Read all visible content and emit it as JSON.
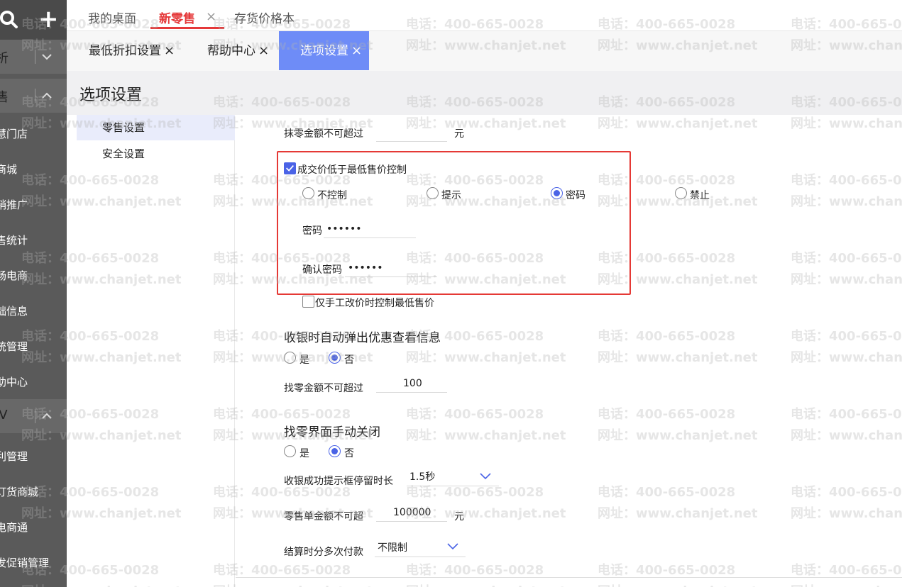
{
  "sidebar": {
    "sections": [
      {
        "label": "析"
      },
      {
        "label": "售"
      },
      {
        "label": "Ⅳ"
      }
    ],
    "items": [
      "慧门店",
      "商城",
      "销推广",
      "售统计",
      "畅电商",
      "础信息",
      "统管理",
      "助中心",
      "利管理",
      "订货商城",
      "电商通",
      "发促销管理"
    ]
  },
  "topbar": {
    "tabs": [
      "我的桌面",
      "新零售",
      "存货价格本"
    ],
    "close": "×"
  },
  "subtabs": {
    "tabs": [
      "最低折扣设置",
      "帮助中心",
      "选项设置"
    ],
    "close": "×"
  },
  "page": {
    "title": "选项设置"
  },
  "leftmenu": {
    "items": [
      "零售设置",
      "安全设置"
    ]
  },
  "form": {
    "round_off_label": "抹零金额不可超过",
    "round_off_value": "",
    "round_off_unit": "元",
    "min_price_control_label": "成交价低于最低售价控制",
    "min_price_control_checked": true,
    "min_price_options": [
      "不控制",
      "提示",
      "密码",
      "禁止"
    ],
    "min_price_selected": "密码",
    "password_label": "密码",
    "password_value": "••••••",
    "confirm_password_label": "确认密码",
    "confirm_password_value": "••••••",
    "manual_only_label": "仅手工改价时控制最低售价",
    "manual_only_checked": false,
    "auto_popup_title": "收银时自动弹出优惠查看信息",
    "auto_popup_options": [
      "是",
      "否"
    ],
    "auto_popup_selected": "否",
    "change_limit_label": "找零金额不可超过",
    "change_limit_value": "100",
    "change_close_title": "找零界面手动关闭",
    "change_close_options": [
      "是",
      "否"
    ],
    "change_close_selected": "否",
    "success_duration_label": "收银成功提示框停留时长",
    "success_duration_value": "1.5秒",
    "single_amount_label": "零售单金额不可超",
    "single_amount_value": "100000",
    "single_amount_unit": "元",
    "multi_pay_label": "结算时分多次付款",
    "multi_pay_value": "不限制"
  },
  "watermark": {
    "phone": "电话：400-665-0028",
    "site": "网址：www.chanjet.net"
  },
  "colors": {
    "accent_red": "#e5393a",
    "active_tab_blue": "#6e8cf7",
    "radio_blue": "#4a63e6",
    "annotation_red": "#e53935"
  }
}
